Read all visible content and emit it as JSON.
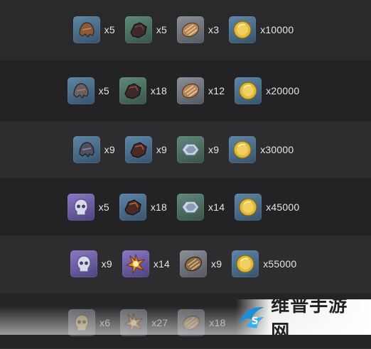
{
  "rows": [
    {
      "items": [
        {
          "icon": "rusted-helmet-icon",
          "bg": "blue",
          "qty": "x5"
        },
        {
          "icon": "dark-pauldron-icon",
          "bg": "green",
          "qty": "x5"
        },
        {
          "icon": "bronze-scale-icon",
          "bg": "gray",
          "qty": "x3"
        },
        {
          "icon": "gold-coin-icon",
          "bg": "blue",
          "qty": "x10000"
        }
      ]
    },
    {
      "items": [
        {
          "icon": "rusted-helmet-icon",
          "bg": "blue",
          "qty": "x5"
        },
        {
          "icon": "dark-pauldron-icon",
          "bg": "green",
          "qty": "x18"
        },
        {
          "icon": "bronze-scale-icon",
          "bg": "gray",
          "qty": "x12"
        },
        {
          "icon": "gold-coin-icon",
          "bg": "blue",
          "qty": "x20000"
        }
      ]
    },
    {
      "items": [
        {
          "icon": "rusted-helmet-icon",
          "bg": "blue",
          "qty": "x9"
        },
        {
          "icon": "dark-pauldron-icon",
          "bg": "blue",
          "qty": "x9"
        },
        {
          "icon": "silver-crystal-icon",
          "bg": "green",
          "qty": "x9"
        },
        {
          "icon": "gold-coin-icon",
          "bg": "blue",
          "qty": "x30000"
        }
      ]
    },
    {
      "items": [
        {
          "icon": "silver-skull-icon",
          "bg": "purple",
          "qty": "x5"
        },
        {
          "icon": "dark-pauldron-icon",
          "bg": "blue",
          "qty": "x18"
        },
        {
          "icon": "silver-crystal-icon",
          "bg": "green",
          "qty": "x14"
        },
        {
          "icon": "gold-coin-icon",
          "bg": "blue",
          "qty": "x45000"
        }
      ]
    },
    {
      "items": [
        {
          "icon": "silver-skull-icon",
          "bg": "purple",
          "qty": "x9"
        },
        {
          "icon": "flame-core-icon",
          "bg": "purple",
          "qty": "x14"
        },
        {
          "icon": "bronze-scale-icon",
          "bg": "gray",
          "qty": "x9"
        },
        {
          "icon": "gold-coin-icon",
          "bg": "blue",
          "qty": "x55000"
        }
      ]
    },
    {
      "items": [
        {
          "icon": "golden-skull-icon",
          "bg": "gray",
          "qty": "x6"
        },
        {
          "icon": "flame-core-icon",
          "bg": "gray",
          "qty": "x27"
        },
        {
          "icon": "bronze-scale-icon",
          "bg": "gray",
          "qty": "x18"
        },
        {
          "icon": "gold-coin-icon",
          "bg": "gray",
          "qty": ""
        }
      ]
    }
  ],
  "watermark": {
    "text": "维普手游网",
    "icon": "watermark-logo-icon"
  },
  "colors": {
    "background": "#2a2a2c",
    "alt_row": "#232325",
    "text": "#e6e6e6"
  }
}
